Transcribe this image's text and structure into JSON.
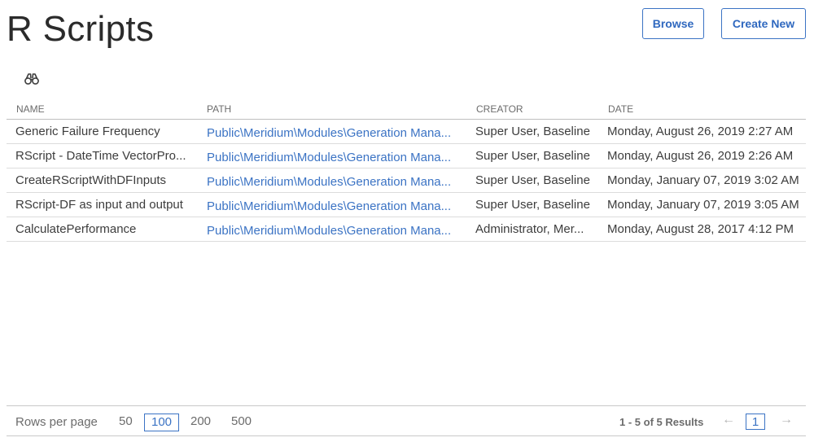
{
  "header": {
    "title": "R Scripts",
    "browse_label": "Browse",
    "create_label": "Create New"
  },
  "search": {
    "icon": "binoculars-icon"
  },
  "table": {
    "columns": [
      "NAME",
      "PATH",
      "CREATOR",
      "DATE"
    ],
    "rows": [
      {
        "name": "Generic Failure Frequency",
        "path": "Public\\Meridium\\Modules\\Generation Mana...",
        "creator": "Super User, Baseline",
        "date": "Monday, August 26, 2019 2:27 AM"
      },
      {
        "name": "RScript - DateTime VectorPro...",
        "path": "Public\\Meridium\\Modules\\Generation Mana...",
        "creator": "Super User, Baseline",
        "date": "Monday, August 26, 2019 2:26 AM"
      },
      {
        "name": "CreateRScriptWithDFInputs",
        "path": "Public\\Meridium\\Modules\\Generation Mana...",
        "creator": "Super User, Baseline",
        "date": "Monday, January 07, 2019 3:02 AM"
      },
      {
        "name": "RScript-DF as input and output",
        "path": "Public\\Meridium\\Modules\\Generation Mana...",
        "creator": "Super User, Baseline",
        "date": "Monday, January 07, 2019 3:05 AM"
      },
      {
        "name": "CalculatePerformance",
        "path": "Public\\Meridium\\Modules\\Generation Mana...",
        "creator": "Administrator, Mer...",
        "date": "Monday, August 28, 2017 4:12 PM"
      }
    ]
  },
  "pager": {
    "rows_label": "Rows per page",
    "sizes": [
      "50",
      "100",
      "200",
      "500"
    ],
    "selected_size": "100",
    "results_text": "1 - 5 of 5 Results",
    "current_page": "1",
    "prev_icon": "arrow-left-icon",
    "next_icon": "arrow-right-icon"
  },
  "colors": {
    "accent": "#3b73c4",
    "text": "#3d3d3d",
    "muted": "#6c6c6c"
  }
}
